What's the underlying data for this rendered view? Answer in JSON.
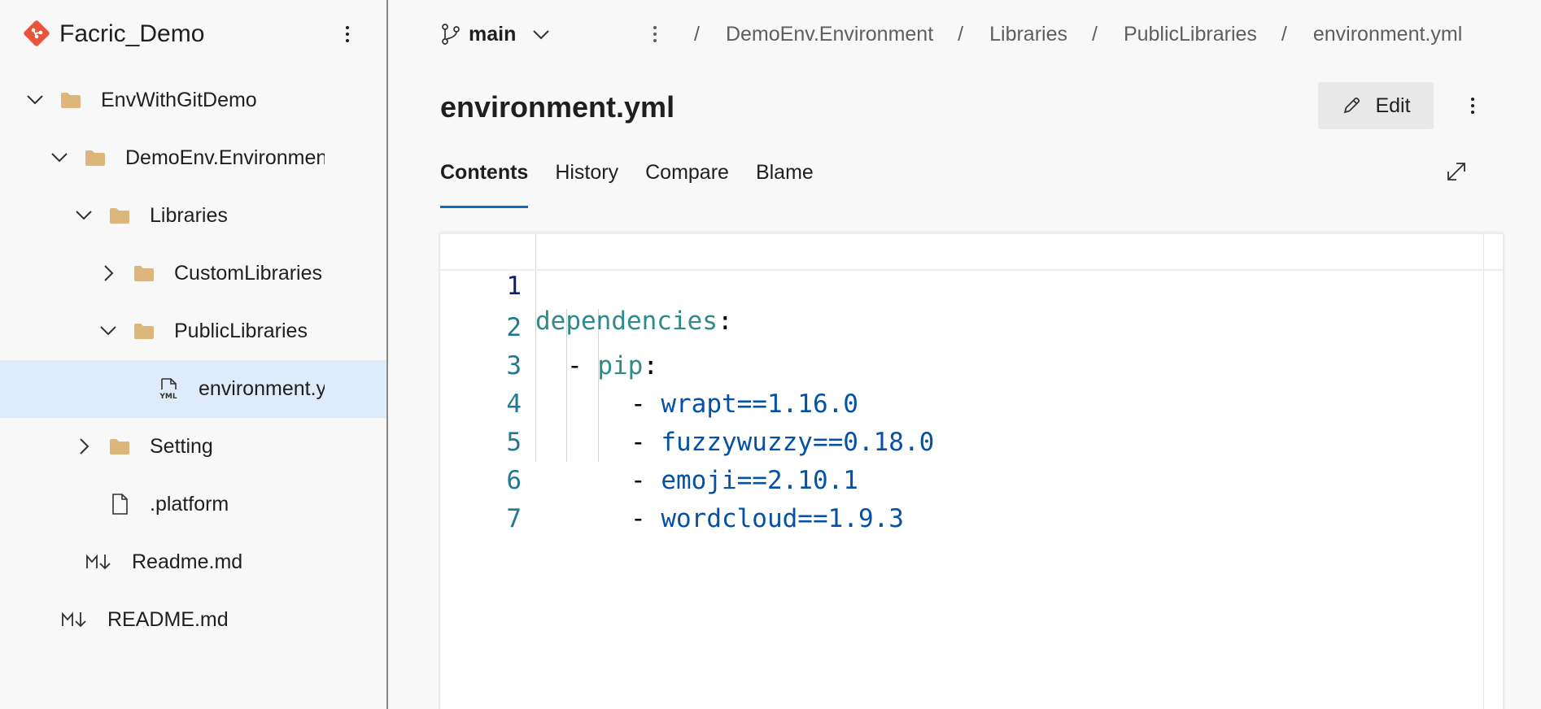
{
  "sidebar": {
    "repo_name": "Facric_Demo",
    "tree": [
      {
        "label": "EnvWithGitDemo",
        "type": "folder",
        "expanded": true
      },
      {
        "label": "DemoEnv.Environment",
        "type": "folder",
        "expanded": true
      },
      {
        "label": "Libraries",
        "type": "folder",
        "expanded": true
      },
      {
        "label": "CustomLibraries",
        "type": "folder",
        "expanded": false
      },
      {
        "label": "PublicLibraries",
        "type": "folder",
        "expanded": true
      },
      {
        "label": "environment.yml",
        "type": "yml-file",
        "selected": true
      },
      {
        "label": "Setting",
        "type": "folder",
        "expanded": false
      },
      {
        "label": ".platform",
        "type": "file"
      },
      {
        "label": "Readme.md",
        "type": "markdown-file"
      },
      {
        "label": "README.md",
        "type": "markdown-file"
      }
    ]
  },
  "topbar": {
    "branch": "main",
    "breadcrumb": [
      "DemoEnv.Environment",
      "Libraries",
      "PublicLibraries",
      "environment.yml"
    ],
    "separator": "/"
  },
  "file": {
    "title": "environment.yml",
    "edit_label": "Edit"
  },
  "tabs": [
    {
      "label": "Contents",
      "active": true
    },
    {
      "label": "History",
      "active": false
    },
    {
      "label": "Compare",
      "active": false
    },
    {
      "label": "Blame",
      "active": false
    }
  ],
  "code": {
    "line_numbers": [
      "1",
      "2",
      "3",
      "4",
      "5",
      "6",
      "7"
    ],
    "lines": [
      {
        "key": "dependencies",
        "colon": ":"
      },
      {
        "dash": "- ",
        "key": "pip",
        "colon": ":"
      },
      {
        "dash": "- ",
        "value": "wrapt==1.16.0"
      },
      {
        "dash": "- ",
        "value": "fuzzywuzzy==0.18.0"
      },
      {
        "dash": "- ",
        "value": "emoji==2.10.1"
      },
      {
        "dash": "- ",
        "value": "wordcloud==1.9.3"
      },
      {}
    ]
  },
  "colors": {
    "accent": "#0f6cbd",
    "selected_row": "#deecf9",
    "git_logo": "#e8553b",
    "folder": "#dcb67a",
    "yaml_key": "#2f8a8a",
    "yaml_value": "#0451a5",
    "line_number": "#237893"
  }
}
